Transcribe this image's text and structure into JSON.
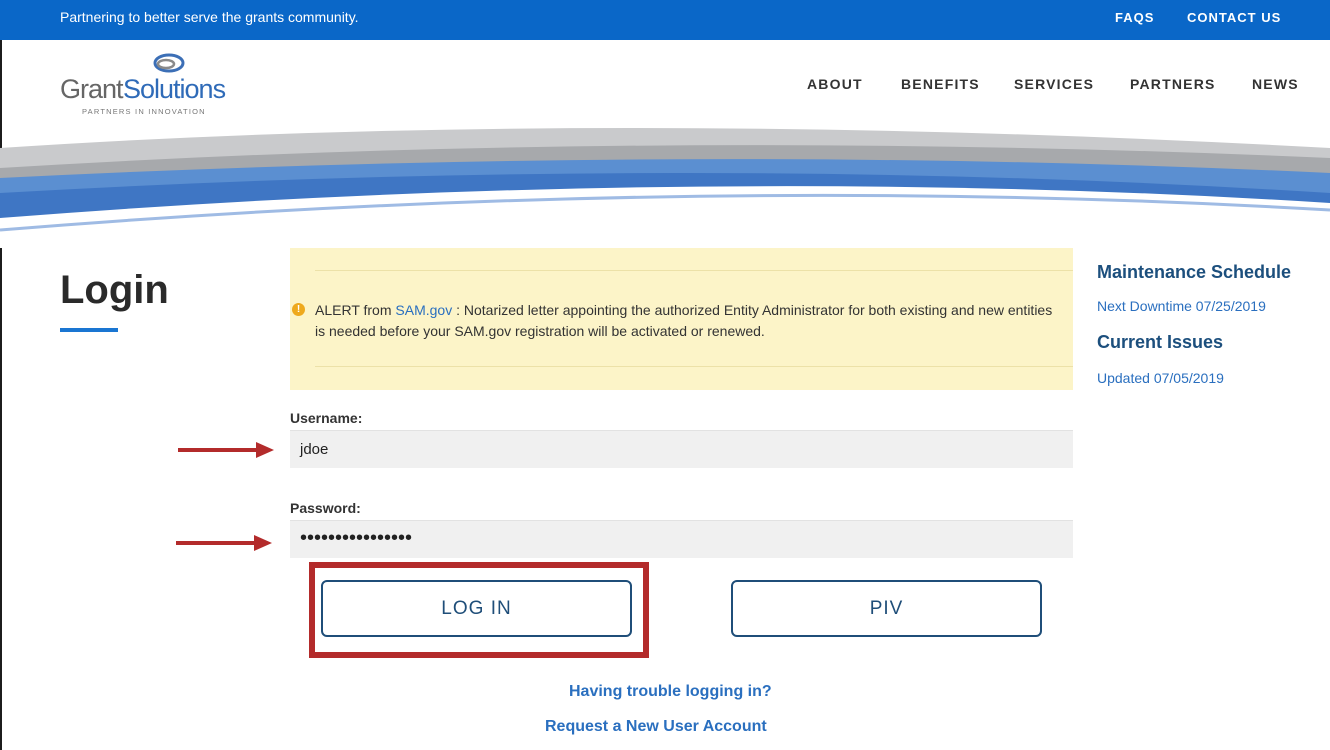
{
  "topbar": {
    "tagline": "Partnering to better serve the grants community.",
    "links": {
      "faqs": "FAQS",
      "contact": "CONTACT US"
    }
  },
  "logo": {
    "wordmark_dark": "Grant",
    "wordmark_blue": "Solutions",
    "tagline": "PARTNERS IN INNOVATION"
  },
  "nav": [
    "ABOUT",
    "BENEFITS",
    "SERVICES",
    "PARTNERS",
    "NEWS"
  ],
  "page": {
    "title": "Login"
  },
  "alert": {
    "prefix": "ALERT from ",
    "link": "SAM.gov",
    "message": " : Notarized letter appointing the authorized Entity Administrator for both existing and new entities is needed before your SAM.gov registration will be activated or renewed."
  },
  "form": {
    "username_label": "Username:",
    "username_value": "jdoe",
    "password_label": "Password:",
    "password_value": "••••••••••••••••",
    "login_button": "LOG IN",
    "piv_button": "PIV"
  },
  "links": {
    "trouble": "Having trouble logging in?",
    "request": "Request a New User Account"
  },
  "sidebar": {
    "maintenance_title": "Maintenance Schedule",
    "maintenance_link": "Next Downtime 07/25/2019",
    "issues_title": "Current Issues",
    "issues_link": "Updated 07/05/2019"
  },
  "colors": {
    "topbar": "#0a67c8",
    "highlight": "#b32b2b",
    "alert_bg": "#fcf4c8",
    "button_border": "#1f4e79"
  }
}
